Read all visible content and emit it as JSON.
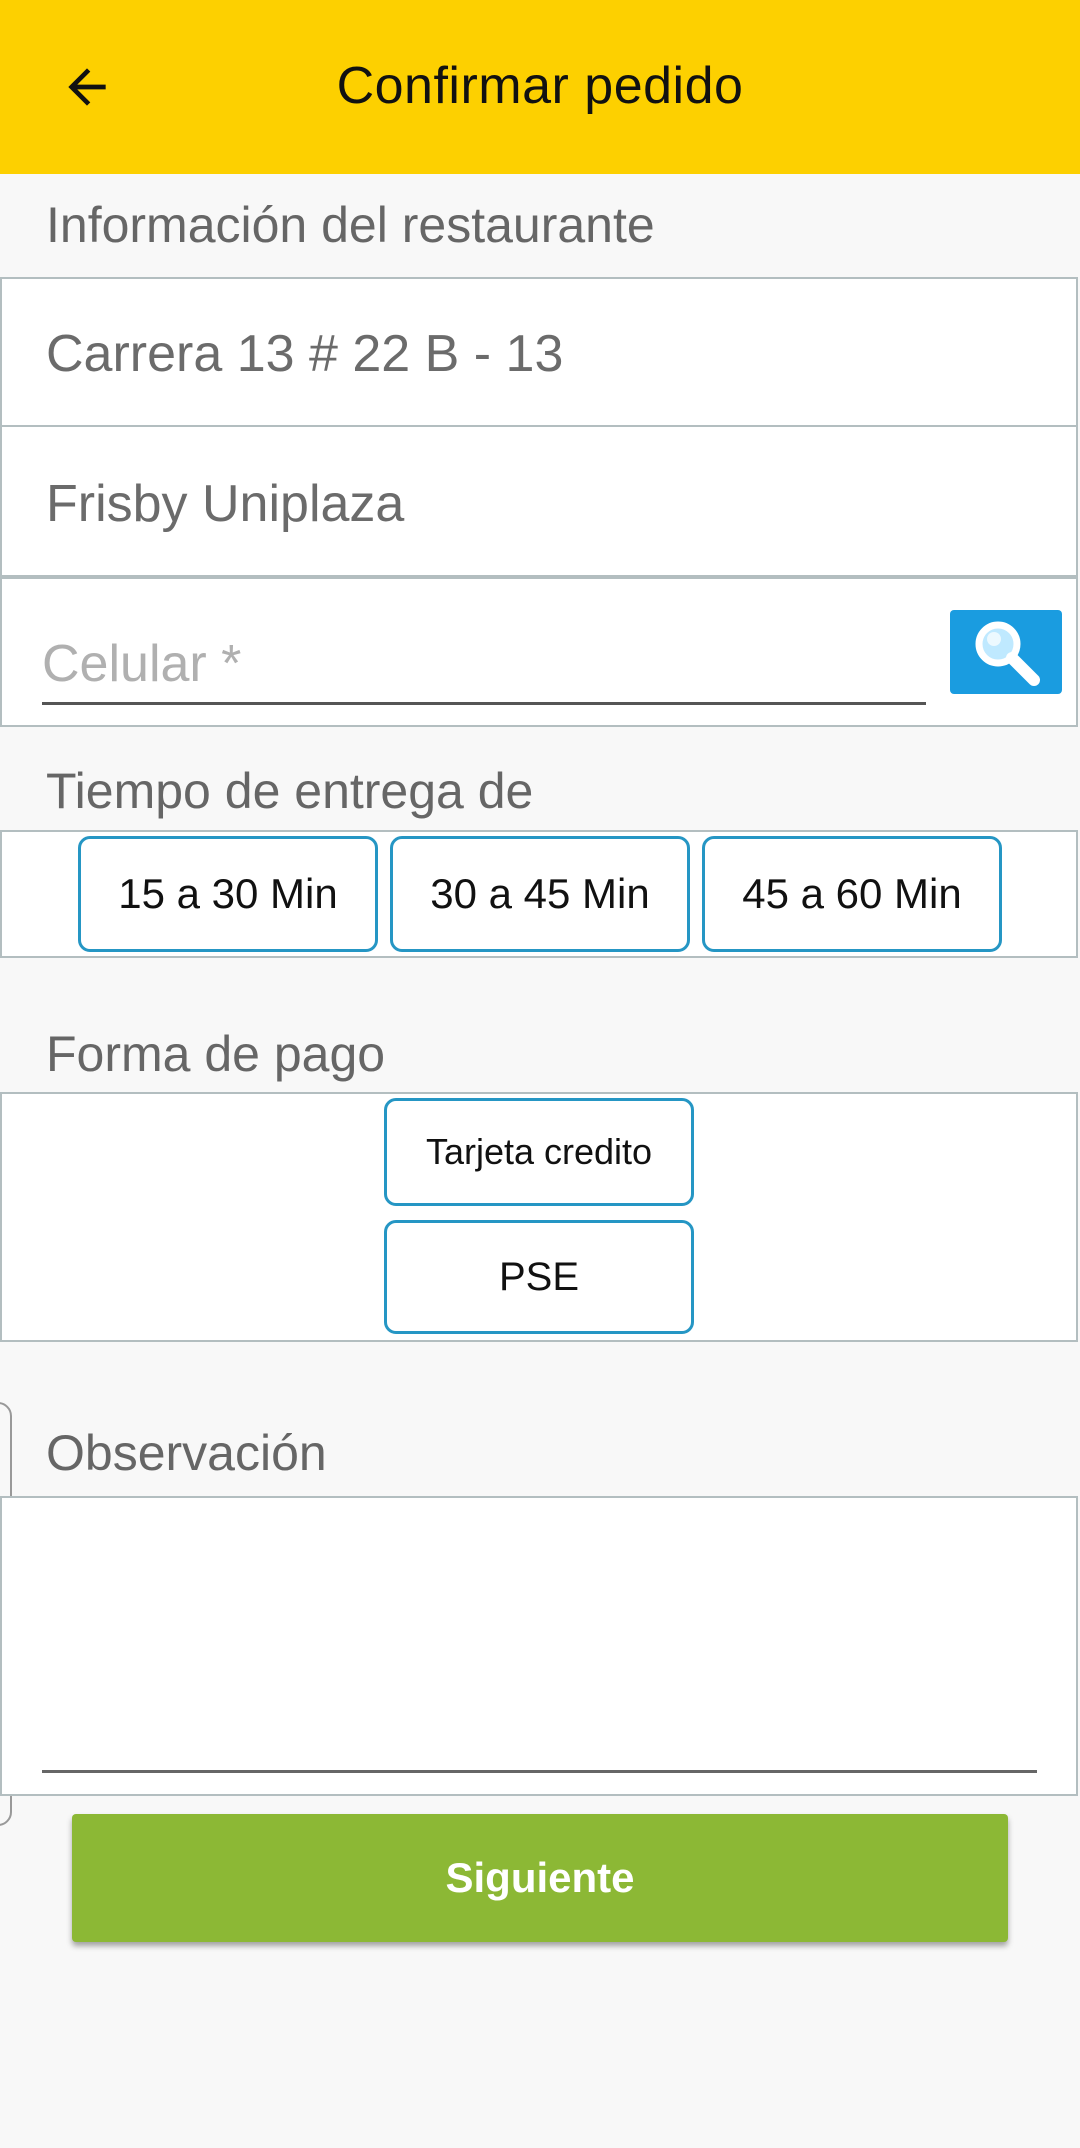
{
  "appbar": {
    "title": "Confirmar pedido",
    "back_icon": "arrow-left-icon",
    "color": "#fdd000"
  },
  "restaurant": {
    "section_label": "Información del restaurante",
    "address": "Carrera 13 # 22 B - 13",
    "name": "Frisby Uniplaza"
  },
  "phone": {
    "placeholder": "Celular *",
    "value": "",
    "search_icon": "search-icon"
  },
  "delivery": {
    "section_label": "Tiempo de entrega de",
    "options": [
      "15 a 30 Min",
      "30 a 45 Min",
      "45 a 60 Min"
    ]
  },
  "payment": {
    "section_label": "Forma de pago",
    "options": [
      "Tarjeta credito",
      "PSE"
    ]
  },
  "observation": {
    "section_label": "Observación",
    "value": ""
  },
  "next_button": {
    "label": "Siguiente",
    "color": "#8cb835"
  },
  "colors": {
    "option_border": "#2596c4",
    "search_button": "#1a9ce0"
  }
}
